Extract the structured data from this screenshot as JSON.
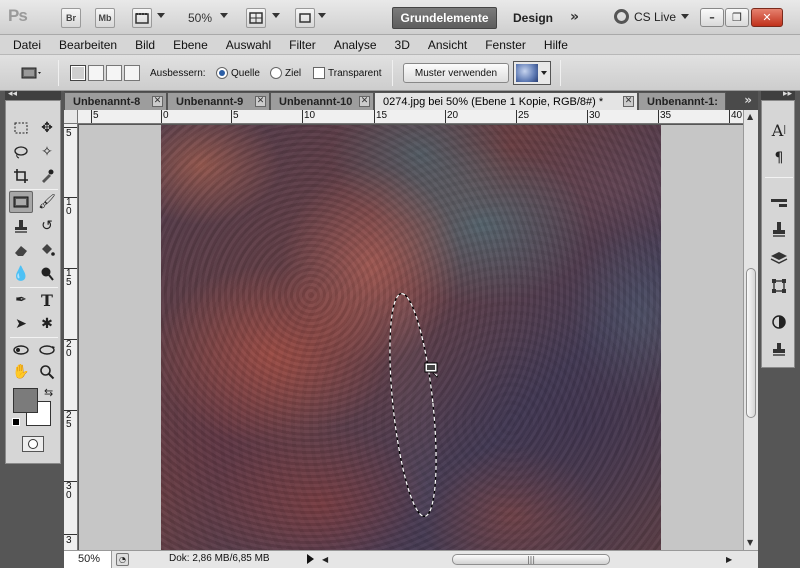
{
  "appbar": {
    "logo": "Ps",
    "bridge": "Br",
    "minibridge": "Mb",
    "zoom": "50%",
    "workspace_active": "Grundelemente",
    "workspace_design": "Design",
    "more": "»",
    "cslive": "CS Live",
    "win_min": "–",
    "win_restore": "❐",
    "win_close": "✕"
  },
  "menu": [
    "Datei",
    "Bearbeiten",
    "Bild",
    "Ebene",
    "Auswahl",
    "Filter",
    "Analyse",
    "3D",
    "Ansicht",
    "Fenster",
    "Hilfe"
  ],
  "options": {
    "label_ausbessern": "Ausbessern:",
    "radio_quelle": "Quelle",
    "radio_ziel": "Ziel",
    "check_transparent": "Transparent",
    "muster_button": "Muster verwenden",
    "quelle_selected": true
  },
  "panel_collapse": {
    "left": "◂◂",
    "right": "▸▸"
  },
  "tabs": [
    {
      "label": "Unbenannt-8",
      "active": false
    },
    {
      "label": "Unbenannt-9",
      "active": false
    },
    {
      "label": "Unbenannt-10",
      "active": false
    },
    {
      "label": "0274.jpg bei 50% (Ebene 1 Kopie, RGB/8#) *",
      "active": true
    },
    {
      "label": "Unbenannt-1:",
      "active": false
    }
  ],
  "tabs_more": "»",
  "tab_close": "✕",
  "ruler_h": [
    "5",
    "0",
    "5",
    "10",
    "15",
    "20",
    "25",
    "30",
    "35",
    "40"
  ],
  "ruler_v": [
    "5",
    "1\n0",
    "1\n5",
    "2\n0",
    "2\n5",
    "3\n0",
    "3"
  ],
  "status": {
    "zoom": "50%",
    "doc": "Dok: 2,86 MB/6,85 MB"
  },
  "colors": {
    "foreground": "#7b7b7b",
    "background": "#ffffff",
    "workspace_active_bg": "#6a6a6a"
  },
  "icons": {
    "tools": [
      "marquee-icon",
      "move-icon",
      "lasso-icon",
      "quick-select-icon",
      "crop-icon",
      "eyedropper-icon",
      "patch-icon",
      "brush-icon",
      "stamp-icon",
      "history-brush-icon",
      "eraser-icon",
      "paint-bucket-icon",
      "blur-icon",
      "dodge-icon",
      "pen-icon",
      "type-icon",
      "path-select-icon",
      "shape-icon",
      "3d-rotate-icon",
      "3d-orbit-icon",
      "hand-icon",
      "zoom-icon"
    ],
    "dock": [
      "character-icon",
      "paragraph-icon",
      "adjustments-icon",
      "clone-source-icon",
      "layers-icon",
      "transform-icon",
      "masks-icon",
      "stamp-panel-icon"
    ]
  }
}
